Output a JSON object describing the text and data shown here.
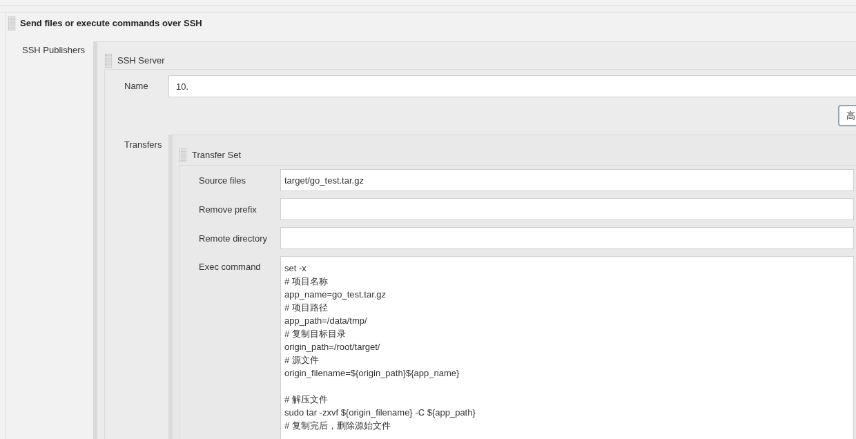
{
  "section": {
    "title": "Send files or execute commands over SSH"
  },
  "publishers": {
    "label": "SSH Publishers",
    "server": {
      "title": "SSH Server",
      "name_label": "Name",
      "name_value": "10.",
      "advanced_button": "高",
      "transfers_label": "Transfers",
      "transfer_set": {
        "title": "Transfer Set",
        "fields": [
          {
            "label": "Source files",
            "value": "target/go_test.tar.gz"
          },
          {
            "label": "Remove prefix"
          },
          {
            "label": "Remote directory"
          }
        ],
        "exec_label": "Exec command",
        "exec_blocks": [
          [
            "set -x",
            "# 项目名称",
            "app_name=go_test.tar.gz",
            "# 项目路径",
            "app_path=/data/tmp/",
            "# 复制目标目录",
            "origin_path=/root/target/",
            "# 源文件",
            "origin_filename=${origin_path}${app_name}"
          ],
          [
            "# 解压文件",
            "sudo tar -zxvf ${origin_filename} -C ${app_path}",
            "# 复制完后，删除源始文件"
          ]
        ]
      }
    }
  }
}
